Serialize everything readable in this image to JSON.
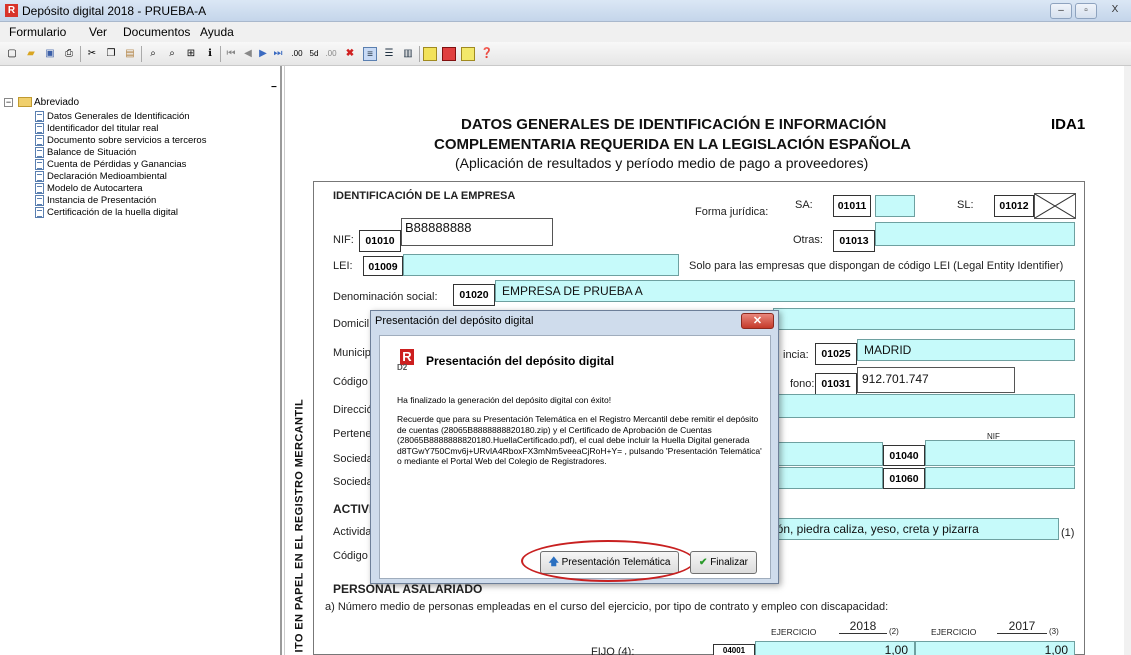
{
  "window": {
    "title": "Depósito digital 2018 - PRUEBA-A",
    "app_icon": "R",
    "minimize": "–",
    "maximize": "▫",
    "close": "X"
  },
  "menu": [
    "Formulario",
    "Ver",
    "Documentos",
    "Ayuda"
  ],
  "tree": {
    "root": "Abreviado",
    "items": [
      "Datos Generales de Identificación",
      "Identificador del titular real",
      "Documento sobre servicios a terceros",
      "Balance de Situación",
      "Cuenta de Pérdidas y Ganancias",
      "Declaración Medioambiental",
      "Modelo de Autocartera",
      "Instancia de Presentación",
      "Certificación de la huella digital"
    ]
  },
  "form": {
    "title1": "DATOS GENERALES DE IDENTIFICACIÓN E INFORMACIÓN",
    "title2": "COMPLEMENTARIA REQUERIDA EN LA LEGISLACIÓN ESPAÑOLA",
    "subtitle": "(Aplicación de resultados y período medio de pago a proveedores)",
    "code": "IDA1",
    "section_identificacion": "IDENTIFICACIÓN DE LA EMPRESA",
    "forma_juridica": "Forma jurídica:",
    "sa": "SA:",
    "sa_code": "01011",
    "sl": "SL:",
    "sl_code": "01012",
    "otras": "Otras:",
    "otras_code": "01013",
    "nif_label": "NIF:",
    "nif_code": "01010",
    "nif_value": "B88888888",
    "lei_label": "LEI:",
    "lei_code": "01009",
    "lei_note": "Solo para las empresas que dispongan de código LEI (Legal Entity Identifier)",
    "denominacion_label": "Denominación social:",
    "denominacion_code": "01020",
    "denominacion_value": "EMPRESA DE PRUEBA A",
    "domicilio_label": "Domicil",
    "municipio_label": "Municip",
    "provincia_label": "incia:",
    "provincia_code": "01025",
    "provincia_value": "MADRID",
    "codigo_label": "Código",
    "telefono_label": "fono:",
    "telefono_code": "01031",
    "telefono_value": "912.701.747",
    "direccion_label": "Direcció",
    "pertenece_label": "Pertene",
    "nif_col": "NIF",
    "sociedad1_label": "Socieda",
    "sociedad1_code": "01040",
    "sociedad2_label": "Socieda",
    "sociedad2_code": "01060",
    "actividad_section": "ACTIVI",
    "actividad_label": "Actividad",
    "actividad_value": "ión, piedra caliza, yeso, creta y pizarra",
    "actividad_note": "(1)",
    "codigo2_label": "Código",
    "personal_section": "PERSONAL ASALARIADO",
    "personal_a": "a) Número medio de personas empleadas en el curso del ejercicio, por tipo de contrato y empleo con discapacidad:",
    "ejercicio_label": "EJERCICIO",
    "ejercicio1": "2018",
    "ejercicio1_note": "(2)",
    "ejercicio2": "2017",
    "ejercicio2_note": "(3)",
    "fijo_label": "FIJO (4):",
    "fijo_code": "04001",
    "fijo1": "1,00",
    "fijo2": "1,00",
    "sidebar_text": "ITO EN PAPEL EN EL REGISTRO MERCANTIL"
  },
  "dialog": {
    "title": "Presentación del depósito digital",
    "heading": "Presentación del depósito digital",
    "logo_sub": "D2",
    "line1": "Ha finalizado la generación del depósito digital con éxito!",
    "line2": "Recuerde que para su Presentación Telemática en el Registro Mercantil debe remitir el depósito de cuentas (28065B8888888820180.zip) y el Certificado de Aprobación de Cuentas (28065B8888888820180.HuellaCertificado.pdf), el cual debe incluir la Huella Digital generada d8TGwY750Cmv6j+URvIA4RboxFX3mNm5veeaCjRoH+Y= , pulsando 'Presentación Telemática' o mediante el Portal Web del Colegio de Registradores.",
    "btn_telematica": "Presentación Telemática",
    "btn_finalizar": "Finalizar"
  },
  "colors": {
    "accent_red": "#cc1f1f",
    "field_cyan": "#c6fafa"
  }
}
